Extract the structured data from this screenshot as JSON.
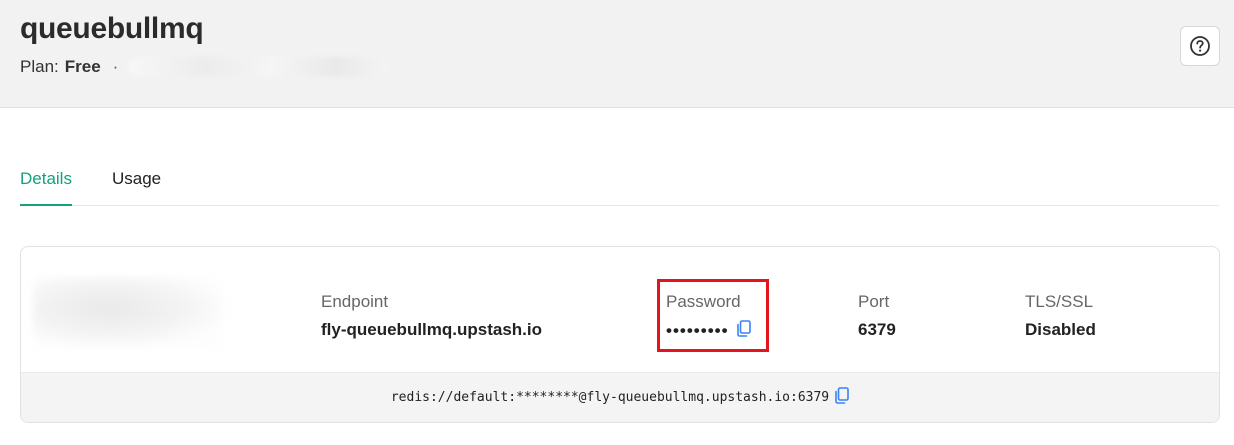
{
  "header": {
    "db_name": "queuebullmq",
    "plan_label": "Plan:",
    "plan_value": "Free",
    "separator": "·",
    "help_icon": "question-circle-icon"
  },
  "tabs": [
    {
      "label": "Details",
      "active": true
    },
    {
      "label": "Usage",
      "active": false
    }
  ],
  "details": {
    "endpoint": {
      "label": "Endpoint",
      "value": "fly-queuebullmq.upstash.io"
    },
    "password": {
      "label": "Password",
      "value": "•••••••••",
      "copy_icon": "copy-icon"
    },
    "port": {
      "label": "Port",
      "value": "6379"
    },
    "tls": {
      "label": "TLS/SSL",
      "value": "Disabled"
    },
    "connection_string": "redis://default:********@fly-queuebullmq.upstash.io:6379",
    "connection_copy_icon": "copy-icon"
  },
  "colors": {
    "accent": "#12a27c",
    "copy_icon": "#3b82f6",
    "highlight": "#e3141e",
    "header_bg": "#f2f2f2"
  }
}
